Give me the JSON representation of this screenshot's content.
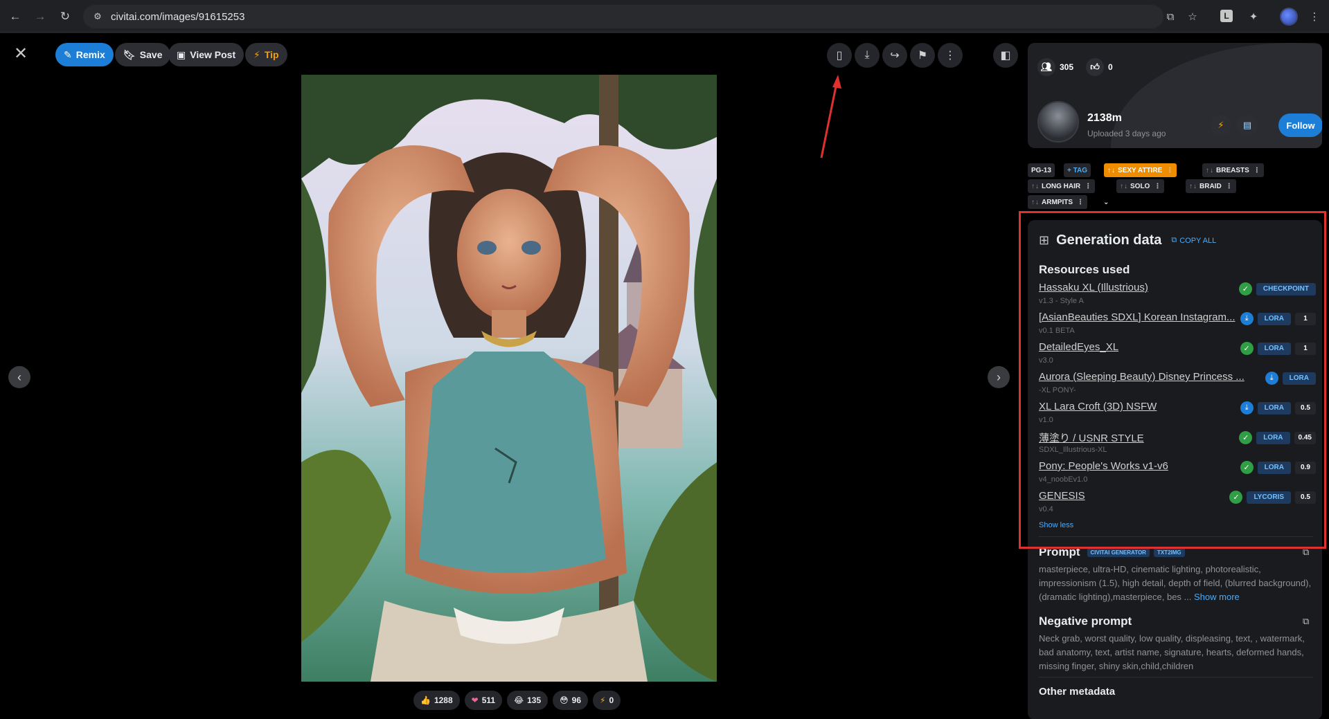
{
  "browser": {
    "url_domain": "civitai.com",
    "url_path": "/images/91615253",
    "ext_label": "L"
  },
  "toolbar": {
    "remix": "Remix",
    "save": "Save",
    "view_post": "View Post",
    "tip": "Tip"
  },
  "reactions": [
    {
      "icon": "👍",
      "count": "1288"
    },
    {
      "icon": "❤",
      "count": "511"
    },
    {
      "icon": "😂",
      "count": "135"
    },
    {
      "icon": "😳",
      "count": "96"
    },
    {
      "icon": "⚡",
      "count": "0"
    }
  ],
  "profile": {
    "followers": "305",
    "likes": "0",
    "username": "2138m",
    "uploaded": "Uploaded 3 days ago",
    "follow_label": "Follow"
  },
  "tags": {
    "rating": "PG-13",
    "add_tag": "+ TAG",
    "items": [
      "SEXY ATTIRE",
      "BREASTS",
      "LONG HAIR",
      "SOLO",
      "BRAID",
      "ARMPITS"
    ]
  },
  "generation": {
    "title": "Generation data",
    "copy_all": "COPY ALL",
    "resources_title": "Resources used",
    "resources": [
      {
        "name": "Hassaku XL (Illustrious)",
        "version": "v1.3 - Style A",
        "type": "CHECKPOINT",
        "weight": "",
        "status": "check"
      },
      {
        "name": "[AsianBeauties SDXL] Korean Instagram...",
        "version": "v0.1 BETA",
        "type": "LORA",
        "weight": "1",
        "status": "download"
      },
      {
        "name": "DetailedEyes_XL",
        "version": "v3.0",
        "type": "LORA",
        "weight": "1",
        "status": "check"
      },
      {
        "name": "Aurora (Sleeping Beauty) Disney Princess ...",
        "version": "-XL PONY-",
        "type": "LORA",
        "weight": "",
        "status": "download"
      },
      {
        "name": "XL Lara Croft (3D) NSFW",
        "version": "v1.0",
        "type": "LORA",
        "weight": "0.5",
        "status": "download"
      },
      {
        "name": "薄塗り / USNR STYLE",
        "version": "SDXL_Illustrious-XL",
        "type": "LORA",
        "weight": "0.45",
        "status": "check"
      },
      {
        "name": "Pony: People's Works v1-v6",
        "version": "v4_noobEv1.0",
        "type": "LORA",
        "weight": "0.9",
        "status": "check"
      },
      {
        "name": "GENESIS",
        "version": "v0.4",
        "type": "LYCORIS",
        "weight": "0.5",
        "status": "check"
      }
    ],
    "show_less": "Show less",
    "prompt_title": "Prompt",
    "prompt_badges": [
      "CIVITAI GENERATOR",
      "TXT2IMG"
    ],
    "prompt_text": "masterpiece, ultra-HD, cinematic lighting, photorealistic, impressionism (1.5), high detail, depth of field, (blurred background), (dramatic lighting),masterpiece, bes ...",
    "show_more": "Show more",
    "negative_title": "Negative prompt",
    "negative_text": "Neck grab, worst quality, low quality, displeasing, text, , watermark, bad anatomy, text, artist name, signature, hearts, deformed hands, missing finger, shiny skin,child,children",
    "other_title": "Other metadata"
  }
}
